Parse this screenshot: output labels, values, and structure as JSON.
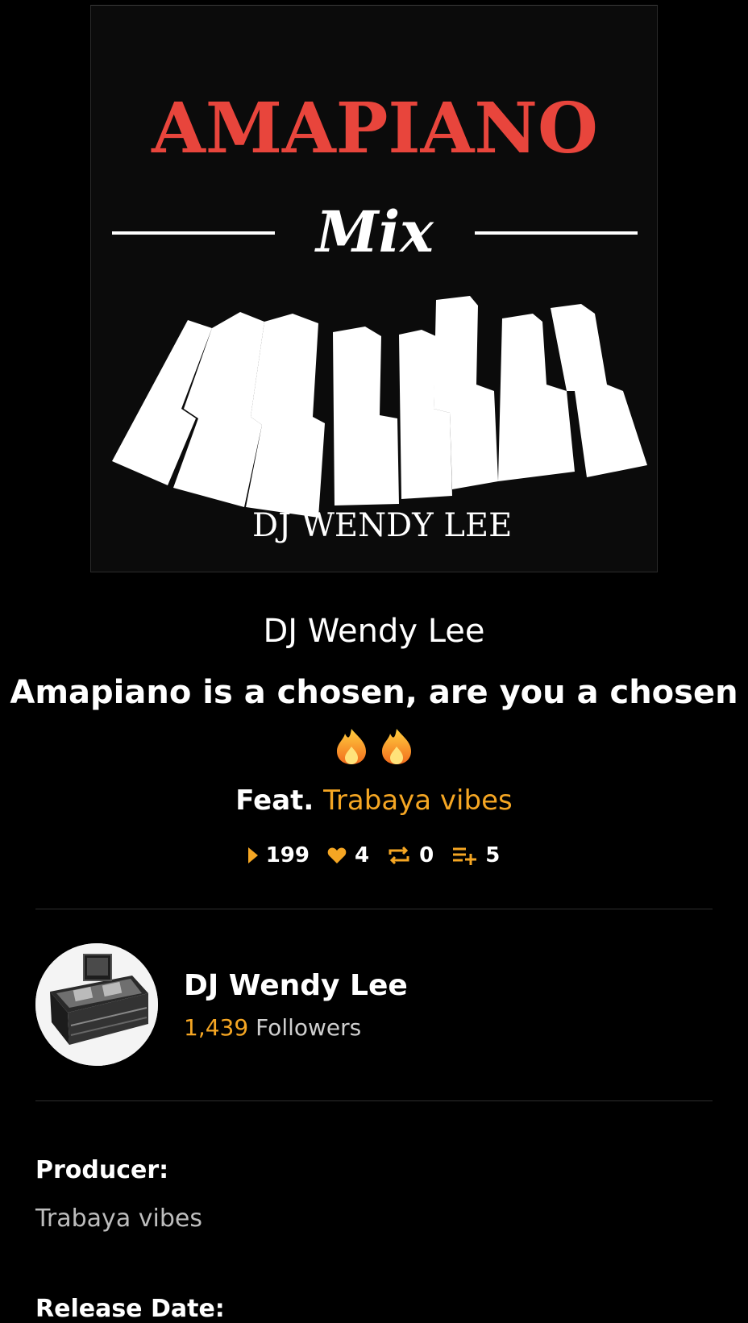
{
  "cover": {
    "title": "AMAPIANO",
    "subtitle": "Mix",
    "artist": "DJ WENDY LEE",
    "title_color": "#e8453c"
  },
  "track": {
    "artist": "DJ Wendy Lee",
    "title": "Amapiano is a chosen, are you a chosen",
    "title_emoji": "🔥🔥",
    "feat_label": "Feat.",
    "feat_artist": "Trabaya vibes"
  },
  "stats": {
    "plays": "199",
    "likes": "4",
    "reposts": "0",
    "playlist_adds": "5"
  },
  "profile": {
    "name": "DJ Wendy Lee",
    "followers_count": "1,439",
    "followers_label": "Followers"
  },
  "details": {
    "producer_label": "Producer:",
    "producer_value": "Trabaya vibes",
    "release_label": "Release Date:"
  },
  "colors": {
    "accent": "#f5a623",
    "background": "#000000"
  },
  "icons": {
    "plays": "play-icon",
    "likes": "heart-icon",
    "reposts": "repost-icon",
    "playlist_adds": "playlist-add-icon"
  }
}
